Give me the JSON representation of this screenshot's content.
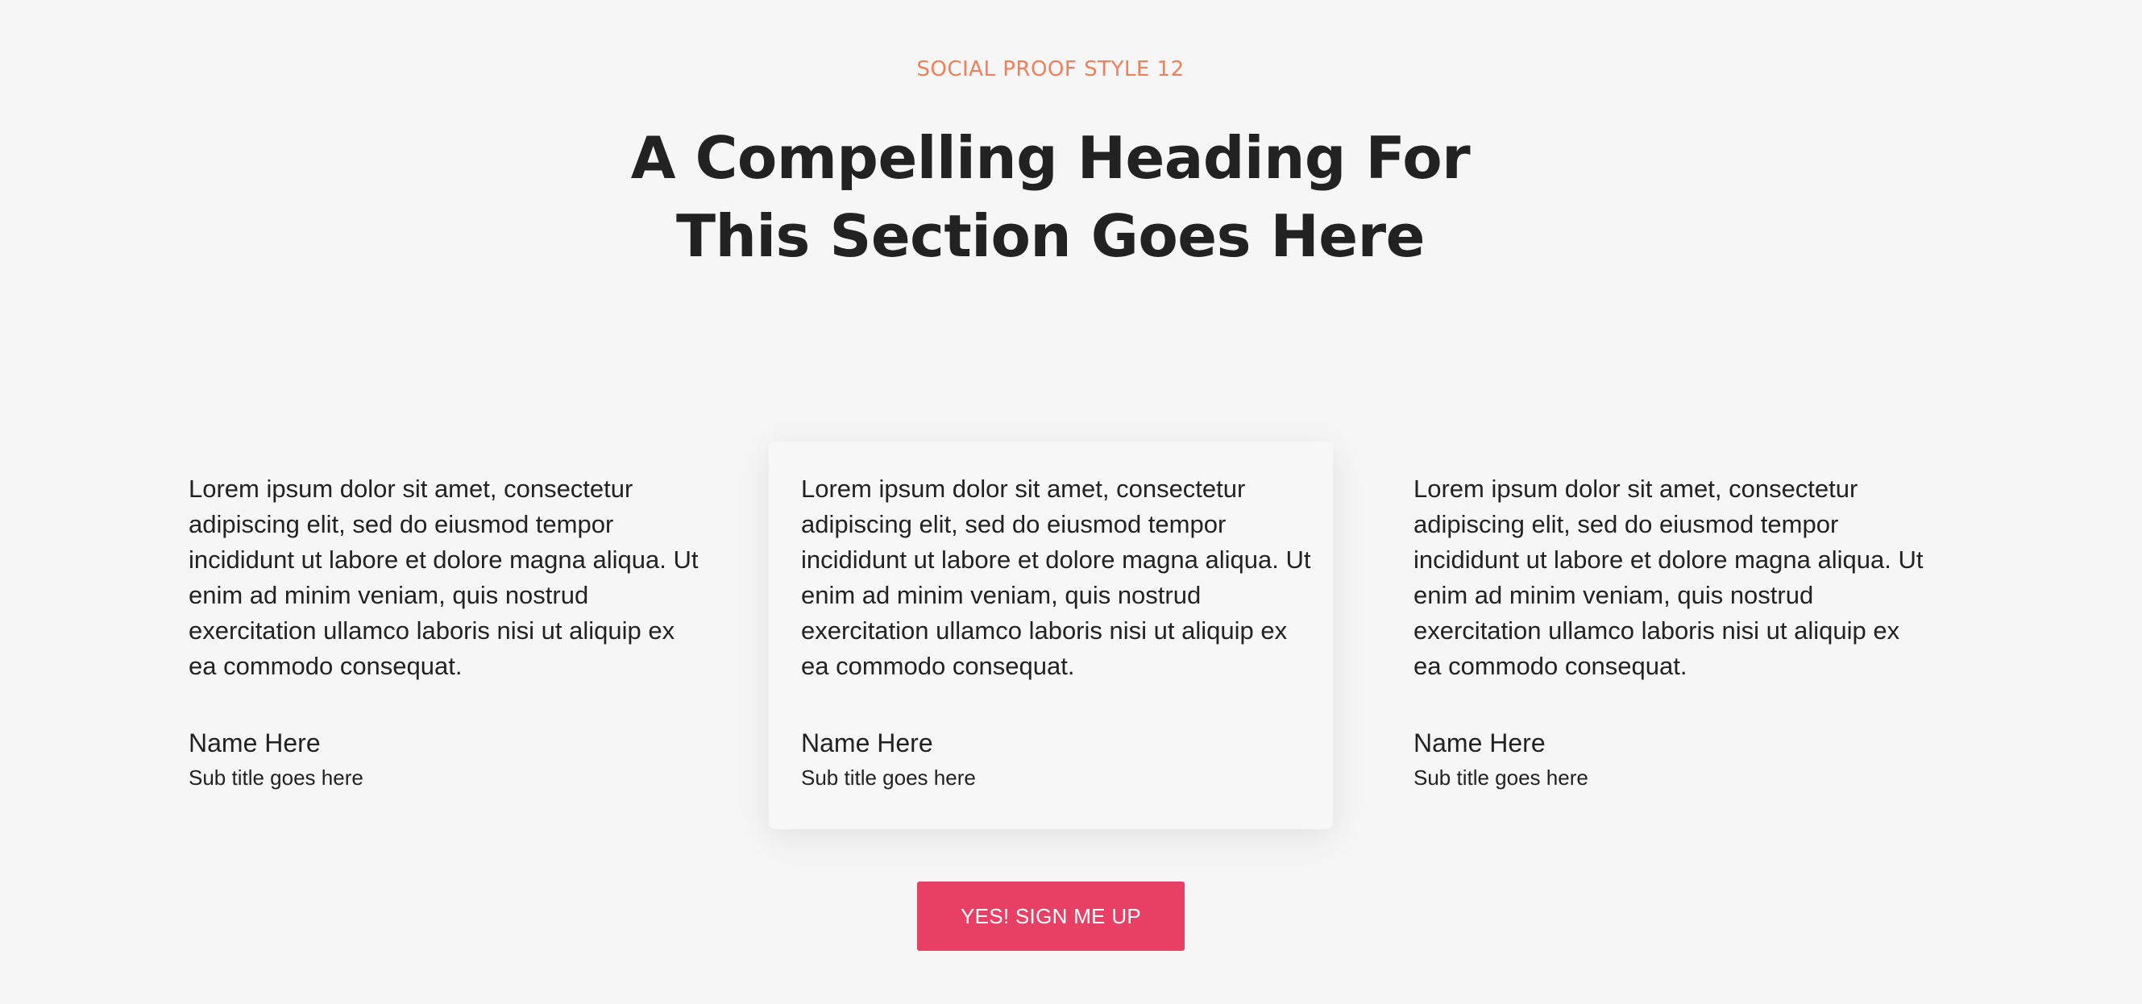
{
  "section": {
    "eyebrow": "SOCIAL PROOF STYLE 12",
    "heading_line_1": "A Compelling Heading For",
    "heading_line_2": "This Section Goes Here"
  },
  "testimonials": [
    {
      "quote": "Lorem ipsum dolor sit amet, consectetur adipiscing elit, sed do eiusmod tempor incididunt ut labore et dolore magna aliqua. Ut enim ad minim veniam, quis nostrud exercitation ullamco laboris nisi ut aliquip ex ea commodo consequat.",
      "name": "Name Here",
      "subtitle": "Sub title goes here"
    },
    {
      "quote": "Lorem ipsum dolor sit amet, consectetur adipiscing elit, sed do eiusmod tempor incididunt ut labore et dolore magna aliqua. Ut enim ad minim veniam, quis nostrud exercitation ullamco laboris nisi ut aliquip ex ea commodo consequat.",
      "name": "Name Here",
      "subtitle": "Sub title goes here"
    },
    {
      "quote": "Lorem ipsum dolor sit amet, consectetur adipiscing elit, sed do eiusmod tempor incididunt ut labore et dolore magna aliqua. Ut enim ad minim veniam, quis nostrud exercitation ullamco laboris nisi ut aliquip ex ea commodo consequat.",
      "name": "Name Here",
      "subtitle": "Sub title goes here"
    }
  ],
  "cta": {
    "label": "YES! SIGN ME UP"
  },
  "colors": {
    "accent": "#f07f5b",
    "button": "#e83f65",
    "text": "#222222",
    "background": "#f6f6f6"
  }
}
